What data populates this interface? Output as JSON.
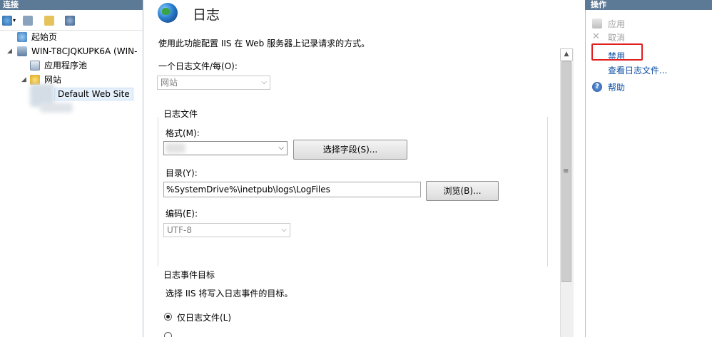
{
  "left_pane": {
    "header": "连接",
    "tree": {
      "start_page": "起始页",
      "server": "WIN-T8CJQKUPK6A (WIN-",
      "app_pools": "应用程序池",
      "sites": "网站",
      "default_site": "Default Web Site"
    }
  },
  "main": {
    "title": "日志",
    "description": "使用此功能配置 IIS 在 Web 服务器上记录请求的方式。",
    "one_log_file_label": "一个日志文件/每(O):",
    "one_log_file_value": "网站",
    "log_file_group": "日志文件",
    "format_label": "格式(M):",
    "format_value": "",
    "select_fields_button": "选择字段(S)...",
    "directory_label": "目录(Y):",
    "directory_value": "%SystemDrive%\\inetpub\\logs\\LogFiles",
    "browse_button": "浏览(B)...",
    "encoding_label": "编码(E):",
    "encoding_value": "UTF-8",
    "event_dest_group": "日志事件目标",
    "event_dest_desc": "选择 IIS 将写入日志事件的目标。",
    "radio_log_only": "仅日志文件(L)"
  },
  "right_pane": {
    "header": "操作",
    "actions": {
      "apply": "应用",
      "cancel": "取消",
      "disable": "禁用",
      "view_logs": "查看日志文件...",
      "help": "帮助"
    }
  },
  "colors": {
    "pane_header": "#5c7996",
    "link": "#0b4ea2",
    "highlight": "#e02020"
  }
}
